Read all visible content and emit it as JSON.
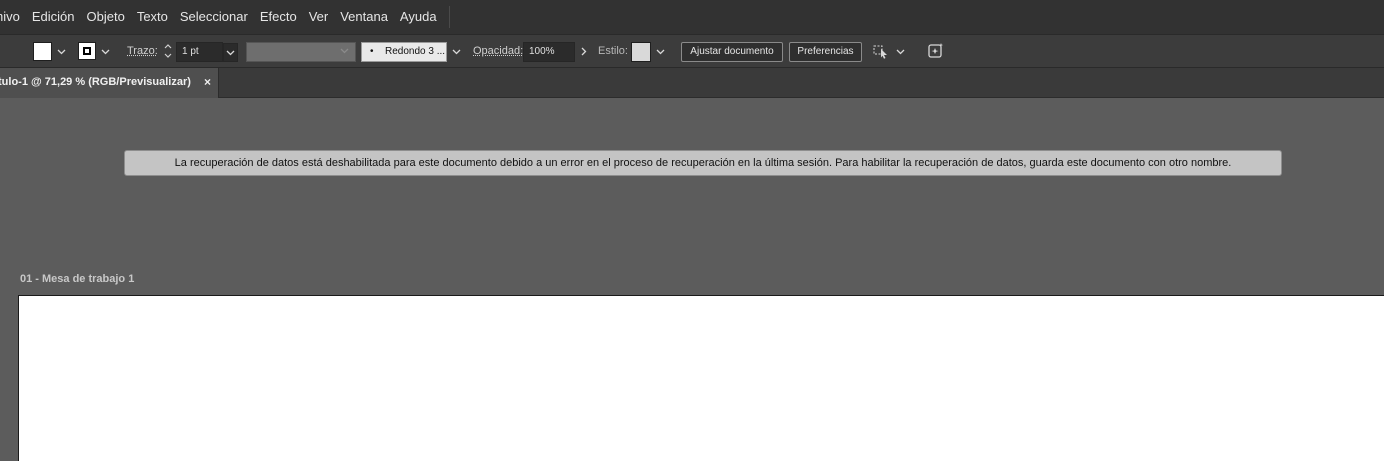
{
  "menubar": {
    "items": [
      "hivo",
      "Edición",
      "Objeto",
      "Texto",
      "Seleccionar",
      "Efecto",
      "Ver",
      "Ventana",
      "Ayuda"
    ]
  },
  "controlbar": {
    "fill_color": "#ffffff",
    "stroke_label": "Trazo:",
    "stroke_weight": "1 pt",
    "brush": "Redondo 3 ...",
    "opacity_label": "Opacidad:",
    "opacity_value": "100%",
    "style_label": "Estilo:",
    "adjust_document_button": "Ajustar documento",
    "preferences_button": "Preferencias",
    "icons": {
      "fill_dropdown": "chevron-down-icon",
      "stroke_dropdown": "chevron-down-icon",
      "weight_spinner": "spinner-icon",
      "weight_dropdown": "chevron-down-icon",
      "brush_dropdown": "chevron-down-icon",
      "opacity_arrow": "chevron-right-icon",
      "style_dropdown": "chevron-down-icon",
      "arrange": "arrange-icon",
      "arrange_dropdown": "chevron-down-icon",
      "recolor": "recolor-icon"
    }
  },
  "tab": {
    "title": "tulo-1 @ 71,29 % (RGB/Previsualizar)",
    "close": "×"
  },
  "canvas": {
    "notice": "La recuperación de datos está deshabilitada para este documento debido a un error en el proceso de recuperación en la última sesión. Para habilitar la recuperación de datos, guarda este documento con otro nombre.",
    "artboard_label": "01 - Mesa de trabajo 1",
    "artboard_color": "#ffffff"
  }
}
